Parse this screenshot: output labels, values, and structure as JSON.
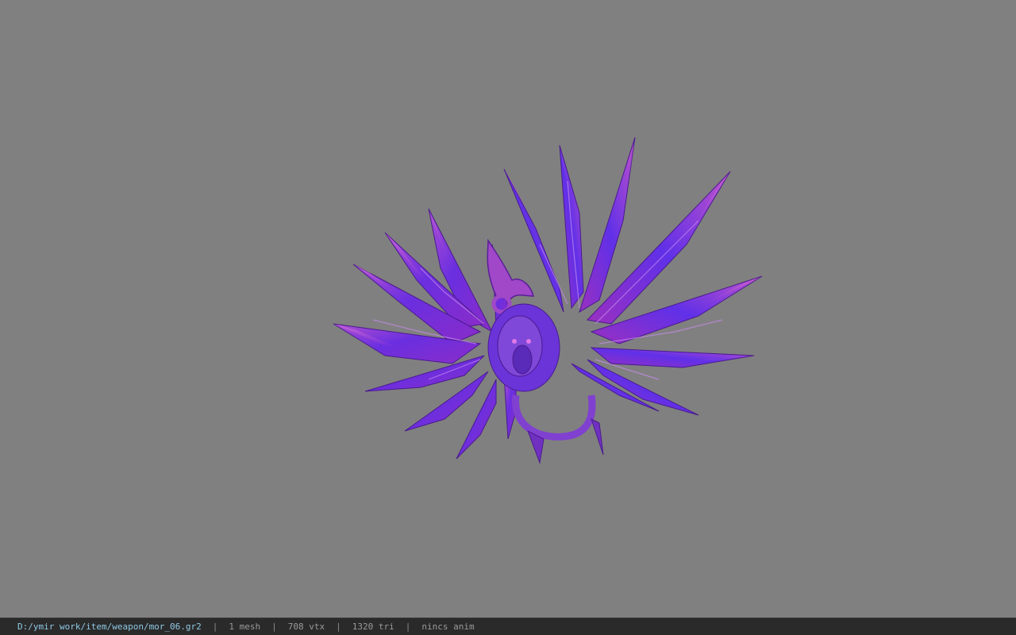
{
  "viewer": {
    "background_color": "#808080",
    "model_icon": "crystal-winged-dragon-weapon-model"
  },
  "status_bar": {
    "file_path": "D:/ymir work/item/weapon/mor_06.gr2",
    "separator": "|",
    "mesh_count": "1 mesh",
    "vertex_count": "708 vtx",
    "triangle_count": "1320 tri",
    "anim_status": "nincs anim"
  }
}
